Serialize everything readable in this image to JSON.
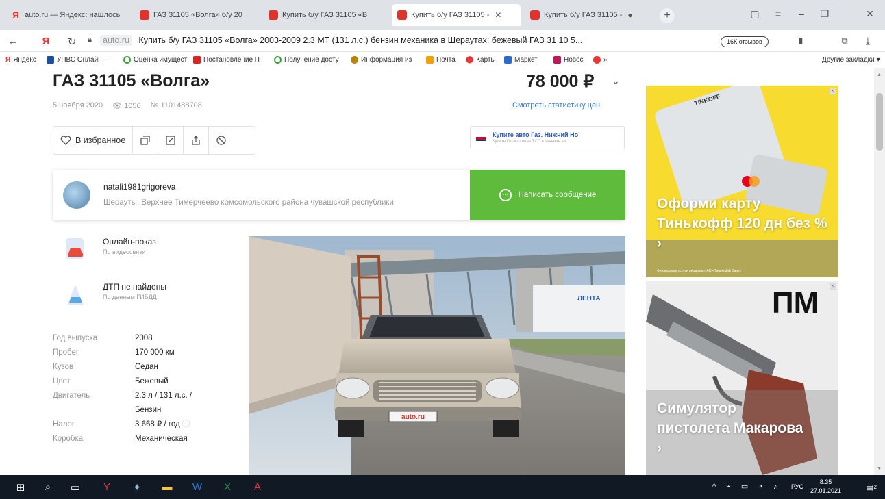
{
  "browser": {
    "tabs": [
      {
        "label": "auto.ru — Яндекс: нашлось",
        "icon": "yandex-icon"
      },
      {
        "label": "ГАЗ 31105 «Волга» б/у 20",
        "icon": "autoru-icon"
      },
      {
        "label": "Купить б/у ГАЗ 31105 «В",
        "icon": "autoru-icon"
      },
      {
        "label": "Купить б/у ГАЗ 31105 -",
        "icon": "autoru-icon",
        "active": true
      },
      {
        "label": "Купить б/у ГАЗ 31105 -",
        "icon": "autoru-icon"
      }
    ],
    "new_tab": "+",
    "address": {
      "yandex_logo": "Я",
      "domain": "auto.ru",
      "title": "Купить б/у ГАЗ 31105 «Волга» 2003-2009 2.3 MT (131 л.с.) бензин механика в Шераутах: бежевый ГАЗ 31 10 5...",
      "reviews": "16К отзывов"
    },
    "bookmarks": [
      {
        "label": "Яндекс"
      },
      {
        "label": "УПВС Онлайн —"
      },
      {
        "label": "Оценка имущест"
      },
      {
        "label": "Постановление П"
      },
      {
        "label": "Получение досту"
      },
      {
        "label": "Информация из"
      },
      {
        "label": "Почта"
      },
      {
        "label": "Карты"
      },
      {
        "label": "Маркет"
      },
      {
        "label": "Новос"
      },
      {
        "label": "»"
      },
      {
        "label": "Другие закладки"
      }
    ],
    "colors": {
      "tabbar": "#dfe3e8",
      "accent_red": "#e0332c"
    }
  },
  "listing": {
    "title": "ГАЗ 31105 «Волга»",
    "price": "78 000 ₽",
    "date": "5 ноября 2020",
    "views": "1056",
    "number": "№ 1101488708",
    "price_stats_link": "Смотреть статистику цен",
    "favorite_label": "В избранное",
    "ad": {
      "title": "Купите авто Газ. Нижний Но",
      "subtitle": "Купите Газ в салоне ТСС в течение ча"
    },
    "seller": {
      "name": "natali1981grigoreva",
      "location": "Шерауты, Верхнее Тимерчеево комсомольского района чувашской республики",
      "message_button": "Написать сообщение"
    },
    "features": [
      {
        "title": "Онлайн-показ",
        "subtitle": "По видеосвязи"
      },
      {
        "title": "ДТП не найдены",
        "subtitle": "По данным ГИБДД"
      }
    ],
    "specs": [
      {
        "k": "Год выпуска",
        "v": "2008"
      },
      {
        "k": "Пробег",
        "v": "170 000 км"
      },
      {
        "k": "Кузов",
        "v": "Седан"
      },
      {
        "k": "Цвет",
        "v": "Бежевый"
      },
      {
        "k": "Двигатель",
        "v": "2.3 л / 131 л.с. / Бензин"
      },
      {
        "k": "Налог",
        "v": "3 668 ₽ / год"
      },
      {
        "k": "Коробка",
        "v": "Механическая"
      }
    ],
    "photo_plate": "auto.ru",
    "photo_truck_text": "ЛЕНТА"
  },
  "sidebar_ads": [
    {
      "brand": "TINKOFF",
      "text": "Оформи карту Тинькофф 120 дн без % ›",
      "footer": "Финансовые услуги оказывает АО «Тинькофф Банк»",
      "color": "#f7dc2f"
    },
    {
      "brand": "ПМ",
      "text": "Симулятор пистолета Макарова ›",
      "color": "#ededed"
    }
  ],
  "taskbar": {
    "language": "РУС",
    "time": "8:35",
    "date": "27.01.2021",
    "notif_count": "2"
  }
}
